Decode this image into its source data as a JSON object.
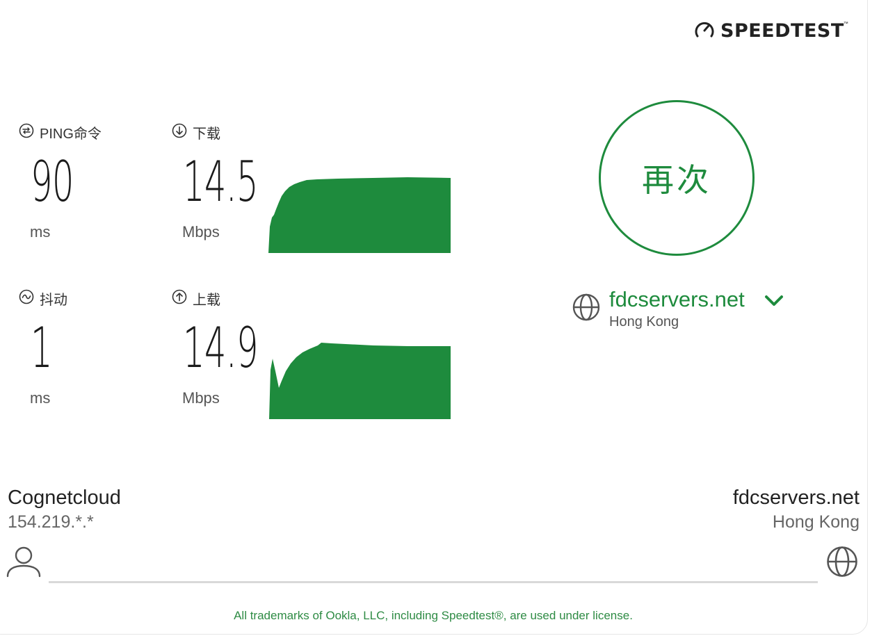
{
  "brand": {
    "name": "SPEEDTEST",
    "tm": "™"
  },
  "metrics": {
    "ping": {
      "label": "PING命令",
      "value": "90",
      "unit": "ms"
    },
    "jitter": {
      "label": "抖动",
      "value": "1",
      "unit": "ms"
    },
    "download": {
      "label": "下载",
      "value": "14.5",
      "unit": "Mbps"
    },
    "upload": {
      "label": "上载",
      "value": "14.9",
      "unit": "Mbps"
    }
  },
  "again_button": {
    "label": "再次"
  },
  "server": {
    "name": "fdcservers.net",
    "location": "Hong Kong"
  },
  "connection": {
    "isp": {
      "name": "Cognetcloud",
      "ip": "154.219.*.*"
    },
    "server": {
      "name": "fdcservers.net",
      "location": "Hong Kong"
    }
  },
  "footer": {
    "text": "All trademarks of Ookla, LLC, including Speedtest®, are used under license."
  },
  "colors": {
    "accent": "#1e8b3d",
    "graph_fill": "#1e8b3d"
  },
  "icons": {
    "logo": "speedometer-icon",
    "ping": "ping-arrows-icon",
    "jitter": "jitter-wave-icon",
    "download": "download-arrow-icon",
    "upload": "upload-arrow-icon",
    "server": "globe-icon",
    "chevron": "chevron-down-icon",
    "user": "user-icon"
  }
}
